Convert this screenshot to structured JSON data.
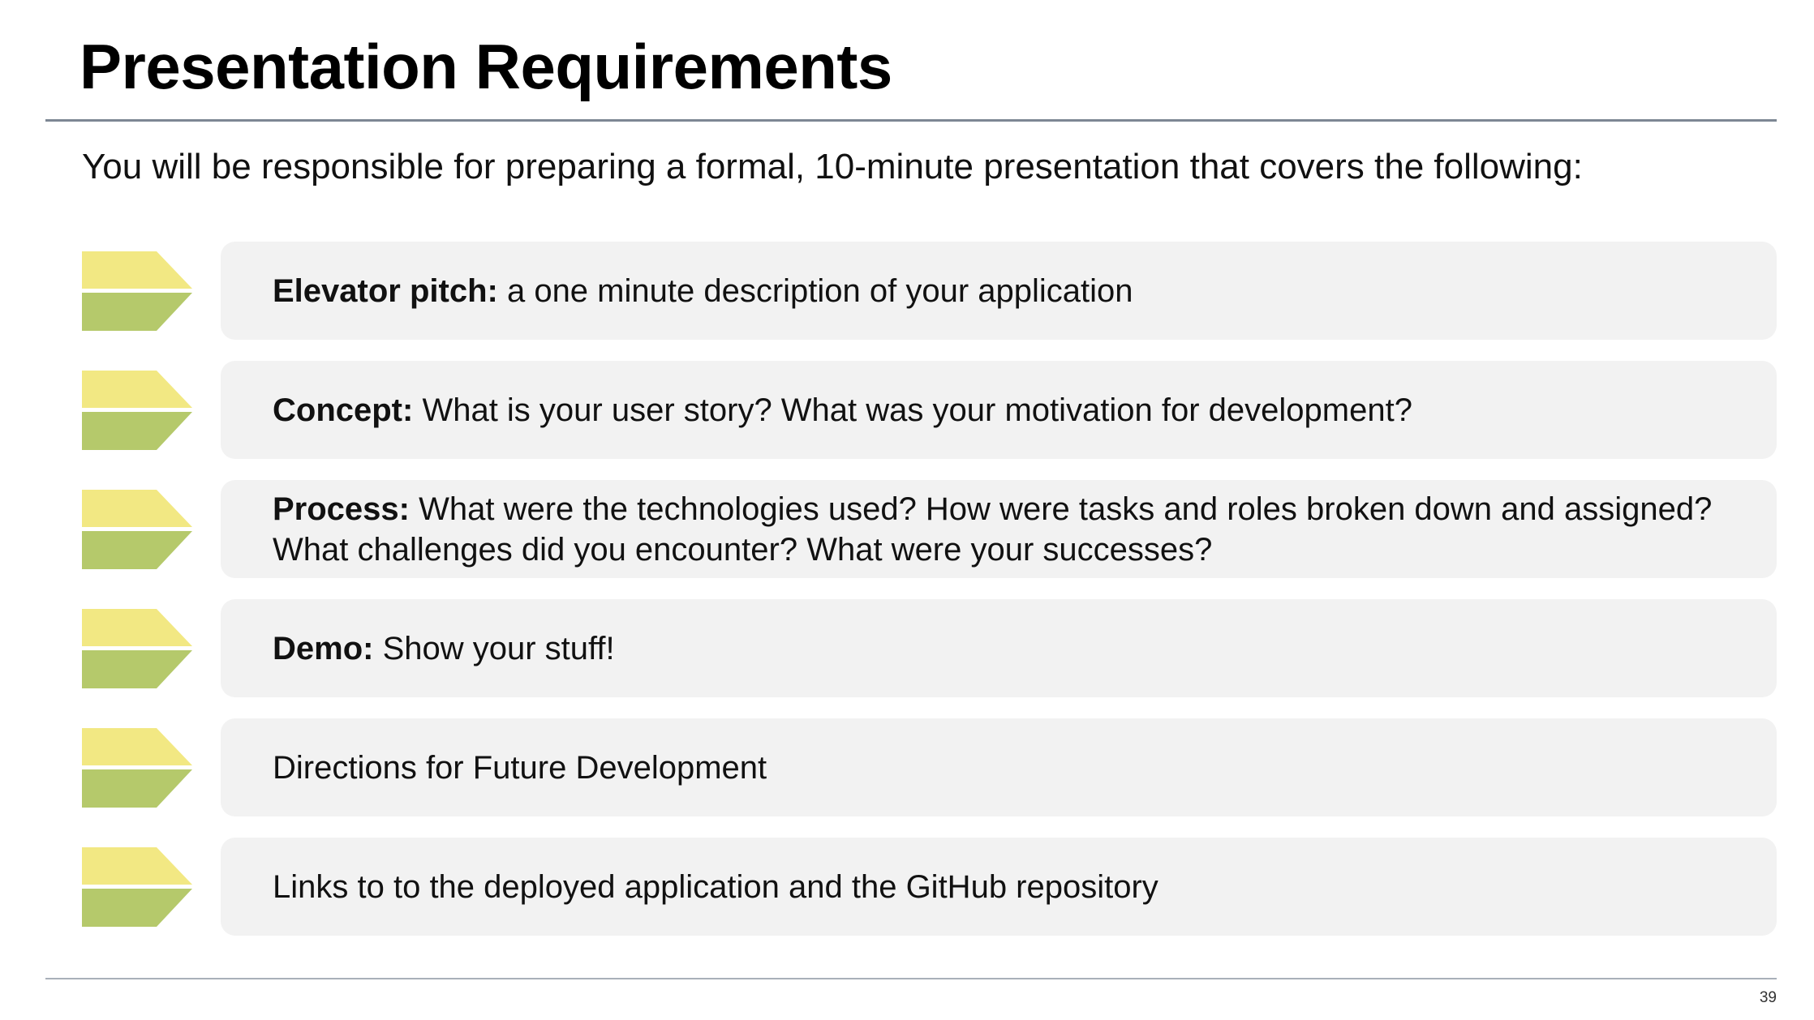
{
  "slide": {
    "title": "Presentation Requirements",
    "intro": "You will be responsible for preparing a formal, 10-minute presentation that covers the following:",
    "page_number": "39"
  },
  "items": [
    {
      "lead": "Elevator pitch:",
      "text": " a one minute description of your application"
    },
    {
      "lead": "Concept:",
      "text": " What is your user story? What was your motivation for development?"
    },
    {
      "lead": "Process:",
      "text": " What were the technologies used? How were tasks and roles broken down and assigned? What challenges did you encounter? What were your successes?"
    },
    {
      "lead": "Demo:",
      "text": " Show your stuff!"
    },
    {
      "lead": "",
      "text": "Directions for Future Development"
    },
    {
      "lead": "",
      "text": "Links to to the deployed application and the GitHub repository"
    }
  ],
  "colors": {
    "chevron_top": "#f2e883",
    "chevron_bottom": "#b5c96b",
    "card_background": "#f2f2f2",
    "rule": "#7d8794"
  },
  "icons": {
    "bullet": "chevron-bullet-icon"
  }
}
